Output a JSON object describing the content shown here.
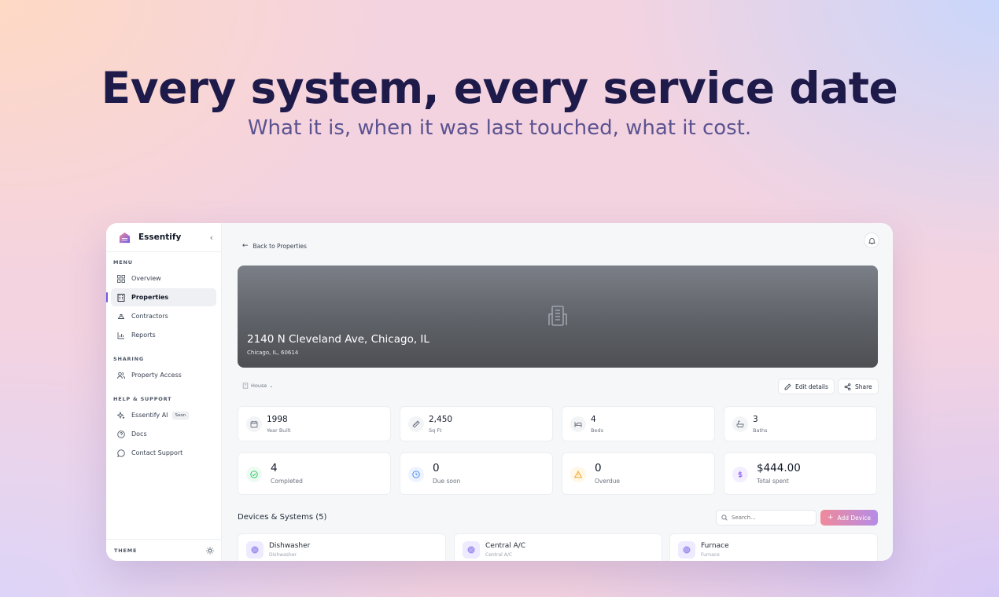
{
  "hero": {
    "title": "Every system, every service date",
    "subtitle": "What it is, when it was last touched, what it cost."
  },
  "sidebar": {
    "brand": "Essentify",
    "sections": {
      "menu": "MENU",
      "sharing": "SHARING",
      "help": "HELP & SUPPORT"
    },
    "items": {
      "overview": "Overview",
      "properties": "Properties",
      "contractors": "Contractors",
      "reports": "Reports",
      "property_access": "Property Access",
      "essentify_ai": "Essentify AI",
      "essentify_ai_badge": "Soon",
      "docs": "Docs",
      "contact_support": "Contact Support"
    },
    "theme_label": "THEME",
    "active_item": "Properties"
  },
  "main": {
    "back_label": "Back to Properties",
    "banner": {
      "title": "2140 N Cleveland Ave, Chicago, IL",
      "subtitle": "Chicago, IL, 60614"
    },
    "property_type": "House",
    "edit_label": "Edit details",
    "share_label": "Share",
    "facts": [
      {
        "value": "1998",
        "label": "Year Built",
        "icon": "calendar-icon"
      },
      {
        "value": "2,450",
        "label": "Sq Ft",
        "icon": "ruler-icon"
      },
      {
        "value": "4",
        "label": "Beds",
        "icon": "bed-icon"
      },
      {
        "value": "3",
        "label": "Baths",
        "icon": "bath-icon"
      }
    ],
    "stats": [
      {
        "value": "4",
        "label": "Completed",
        "icon": "check-circle-icon",
        "color": "#22c55e"
      },
      {
        "value": "0",
        "label": "Due soon",
        "icon": "clock-icon",
        "color": "#3b82f6"
      },
      {
        "value": "0",
        "label": "Overdue",
        "icon": "warning-icon",
        "color": "#f59e0b"
      },
      {
        "value": "$444.00",
        "label": "Total spent",
        "icon": "dollar-icon",
        "color": "#8b5cf6"
      }
    ],
    "devices": {
      "title": "Devices & Systems (5)",
      "search_placeholder": "Search...",
      "add_label": "Add Device",
      "items": [
        {
          "name": "Dishwasher",
          "sub": "Dishwasher"
        },
        {
          "name": "Central A/C",
          "sub": "Central A/C"
        },
        {
          "name": "Furnace",
          "sub": "Furnace"
        }
      ]
    }
  },
  "colors": {
    "accent": "#6d5ae6",
    "hero_title": "#1e1b4b",
    "hero_subtitle": "#5b5391"
  }
}
